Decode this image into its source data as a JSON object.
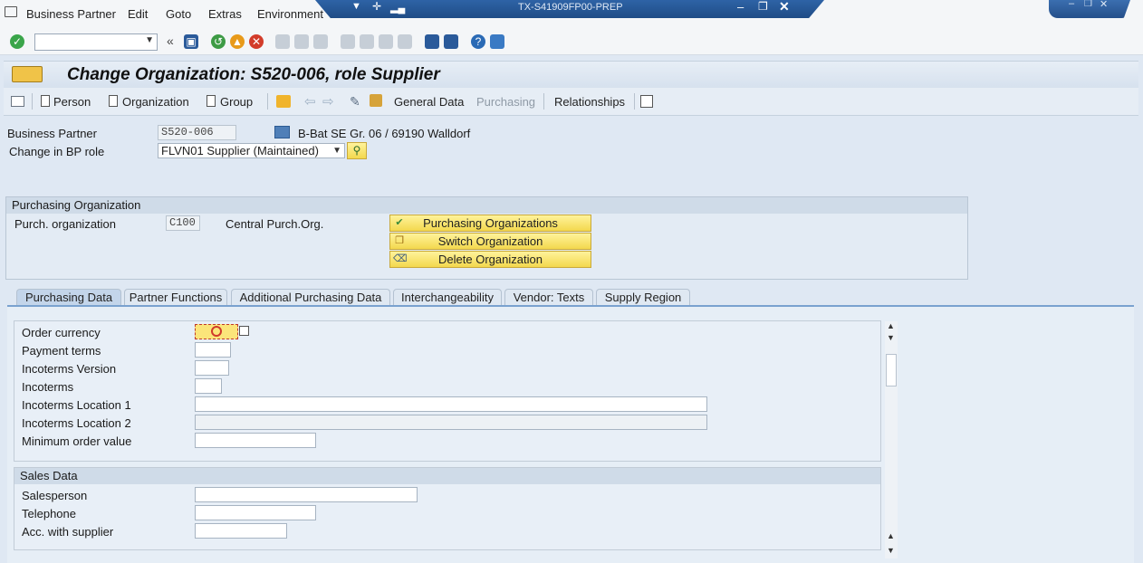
{
  "menu": {
    "items": [
      "Business Partner",
      "Edit",
      "Goto",
      "Extras",
      "Environment"
    ]
  },
  "window": {
    "system_title": "TX-S41909FP00-PREP"
  },
  "page": {
    "title": "Change Organization: S520-006, role Supplier"
  },
  "app_toolbar": {
    "person": "Person",
    "organization": "Organization",
    "group": "Group",
    "general_data": "General Data",
    "purchasing": "Purchasing",
    "relationships": "Relationships"
  },
  "header_fields": {
    "bp_label": "Business Partner",
    "bp_value": "S520-006",
    "bp_description": "B-Bat SE Gr. 06 / 69190 Walldorf",
    "role_label": "Change in BP role",
    "role_value": "FLVN01 Supplier (Maintained)"
  },
  "purch_org": {
    "group_title": "Purchasing Organization",
    "label": "Purch. organization",
    "value": "C100",
    "description": "Central Purch.Org.",
    "buttons": [
      "Purchasing Organizations",
      "Switch Organization",
      "Delete Organization"
    ]
  },
  "tabs": [
    "Purchasing Data",
    "Partner Functions",
    "Additional Purchasing Data",
    "Interchangeability",
    "Vendor: Texts",
    "Supply Region"
  ],
  "purchasing_data": {
    "fields": [
      "Order currency",
      "Payment terms",
      "Incoterms Version",
      "Incoterms",
      "Incoterms Location 1",
      "Incoterms Location 2",
      "Minimum order value"
    ]
  },
  "sales_data": {
    "title": "Sales Data",
    "fields": [
      "Salesperson",
      "Telephone",
      "Acc. with supplier"
    ]
  },
  "colors": {
    "accent": "#2e63a6",
    "button_yellow": "#f3d84e",
    "tab_underline": "#7aa2cf"
  }
}
